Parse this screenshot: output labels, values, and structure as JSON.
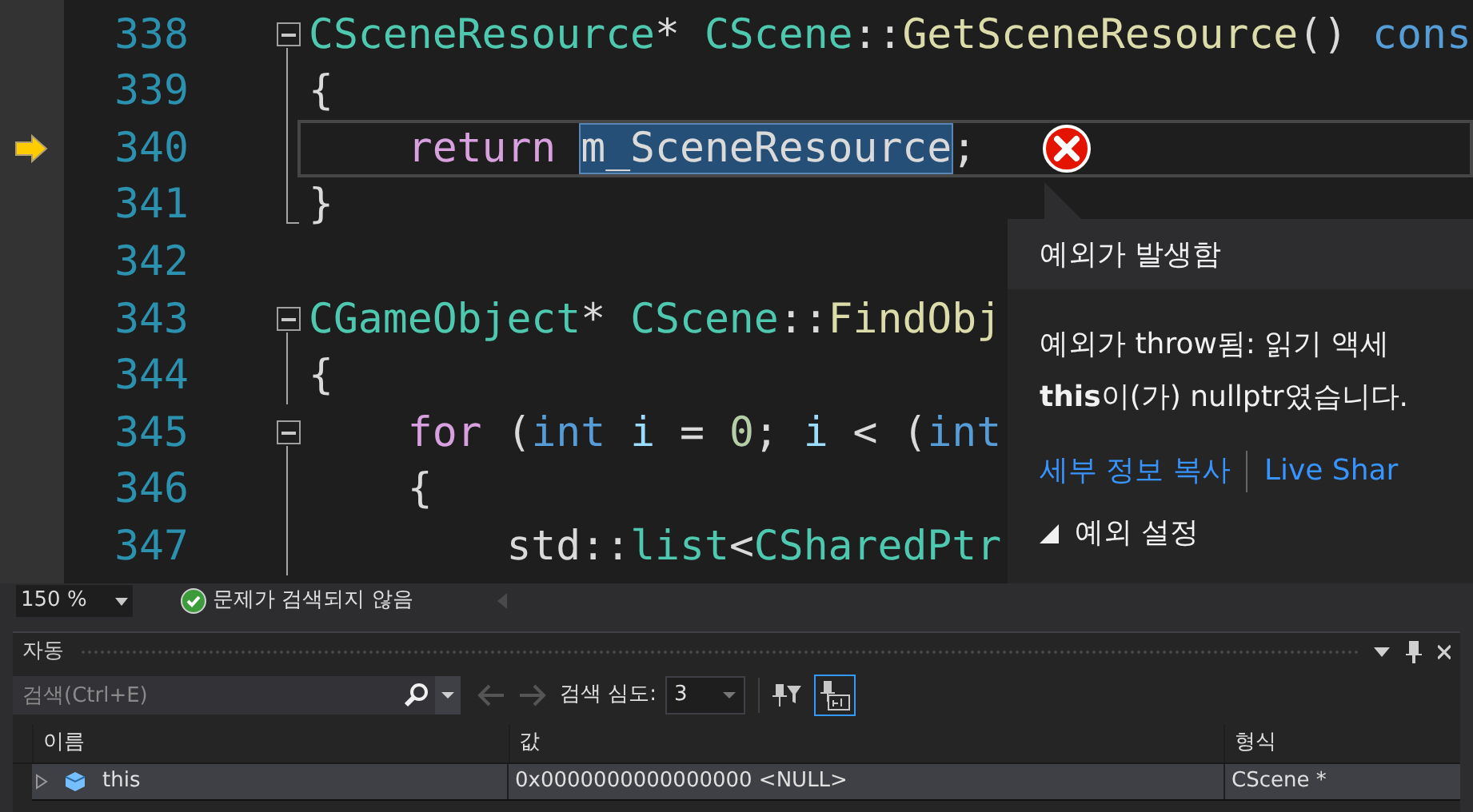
{
  "editor": {
    "lines": [
      {
        "number": "338",
        "current": false,
        "collapse_button": true,
        "block_end": false,
        "tokens": [
          {
            "kind": "type",
            "text": "CSceneResource"
          },
          {
            "kind": "plain",
            "text": "* "
          },
          {
            "kind": "type",
            "text": "CScene"
          },
          {
            "kind": "plain",
            "text": "::"
          },
          {
            "kind": "func",
            "text": "GetSceneResource"
          },
          {
            "kind": "plain",
            "text": "() "
          },
          {
            "kind": "builtin",
            "text": "cons"
          }
        ]
      },
      {
        "number": "339",
        "current": false,
        "collapse_button": false,
        "block_end": false,
        "tokens": [
          {
            "kind": "plain",
            "text": "{"
          }
        ]
      },
      {
        "number": "340",
        "current": true,
        "collapse_button": false,
        "block_end": false,
        "tokens": [
          {
            "kind": "keyword",
            "text": "    return "
          },
          {
            "kind": "selection",
            "text": "m_SceneResource"
          },
          {
            "kind": "plain",
            "text": ";"
          }
        ]
      },
      {
        "number": "341",
        "current": false,
        "collapse_button": false,
        "block_end": true,
        "tokens": [
          {
            "kind": "plain",
            "text": "}"
          }
        ]
      },
      {
        "number": "342",
        "current": false,
        "collapse_button": false,
        "block_end": false
      },
      {
        "number": "343",
        "current": false,
        "collapse_button": true,
        "block_end": false,
        "tokens": [
          {
            "kind": "type",
            "text": "CGameObject"
          },
          {
            "kind": "plain",
            "text": "* "
          },
          {
            "kind": "type",
            "text": "CScene"
          },
          {
            "kind": "plain",
            "text": "::"
          },
          {
            "kind": "func",
            "text": "FindObj"
          }
        ]
      },
      {
        "number": "344",
        "current": false,
        "collapse_button": false,
        "block_end": false,
        "tokens": [
          {
            "kind": "plain",
            "text": "{"
          }
        ]
      },
      {
        "number": "345",
        "current": false,
        "collapse_button": true,
        "block_end": false,
        "tokens": [
          {
            "kind": "keyword",
            "text": "    for"
          },
          {
            "kind": "plain",
            "text": " ("
          },
          {
            "kind": "builtin",
            "text": "int"
          },
          {
            "kind": "var",
            "text": " i"
          },
          {
            "kind": "plain",
            "text": " = "
          },
          {
            "kind": "number",
            "text": "0"
          },
          {
            "kind": "plain",
            "text": "; "
          },
          {
            "kind": "var",
            "text": "i"
          },
          {
            "kind": "plain",
            "text": " < ("
          },
          {
            "kind": "builtin",
            "text": "int"
          }
        ]
      },
      {
        "number": "346",
        "current": false,
        "collapse_button": false,
        "block_end": false,
        "tokens": [
          {
            "kind": "plain",
            "text": "    {"
          }
        ]
      },
      {
        "number": "347",
        "current": false,
        "collapse_button": false,
        "block_end": false,
        "tokens": [
          {
            "kind": "plain",
            "text": "        std::"
          },
          {
            "kind": "type",
            "text": "list"
          },
          {
            "kind": "plain",
            "text": "<"
          },
          {
            "kind": "type",
            "text": "CSharedPtr"
          }
        ]
      }
    ]
  },
  "exception_popup": {
    "title": "예외가 발생함",
    "message_line_1": "예외가 throw됨: 읽기 액세",
    "message_line_2": "**this**이(가) nullptr였습니다.",
    "links": [
      "세부 정보 복사",
      "Live Shar"
    ],
    "section": {
      "label": "예외 설정",
      "expanded": true
    }
  },
  "status_bar": {
    "zoom": "150 %",
    "issues": "문제가 검색되지 않음"
  },
  "autos_panel": {
    "title": "자동",
    "search": {
      "placeholder": "검색(Ctrl+E)"
    },
    "depth_label": "검색 심도:",
    "depth_value": "3",
    "columns": [
      "이름",
      "값",
      "형식"
    ],
    "rows": [
      {
        "name": "this",
        "value": "0x0000000000000000 <NULL>",
        "type": "CScene *",
        "expanded": false
      }
    ]
  }
}
